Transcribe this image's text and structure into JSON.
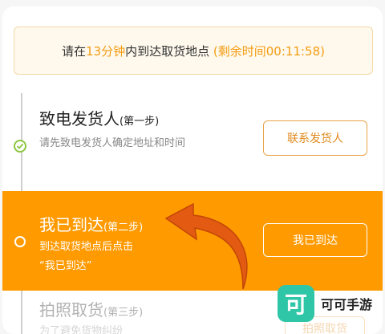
{
  "notice": {
    "prefix": "请在",
    "minutes": "13分钟",
    "middle": "内到达取货地点",
    "remaining": "(剩余时间00:11:58)"
  },
  "step1": {
    "title": "致电发货人",
    "sub": "(第一步)",
    "desc": "请先致电发货人确定地址和时间",
    "button": "联系发货人",
    "icon": "check-circle-icon",
    "icon_color": "#8cc63f"
  },
  "step2": {
    "title": "我已到达",
    "sub": "(第二步)",
    "desc_line1": "到达取货地点后点击",
    "desc_line2": "“我已到达”",
    "button": "我已到达",
    "band_color": "#ff9a00"
  },
  "step3": {
    "title": "拍照取货",
    "sub": "(第三步)",
    "desc": "为了避免货物纠纷",
    "button": "拍照取货"
  },
  "watermark": {
    "logo_char": "可",
    "text": "可可手游",
    "color": "#2ec6a7"
  },
  "colors": {
    "accent": "#f39c12",
    "button_border": "#e9a44a"
  }
}
